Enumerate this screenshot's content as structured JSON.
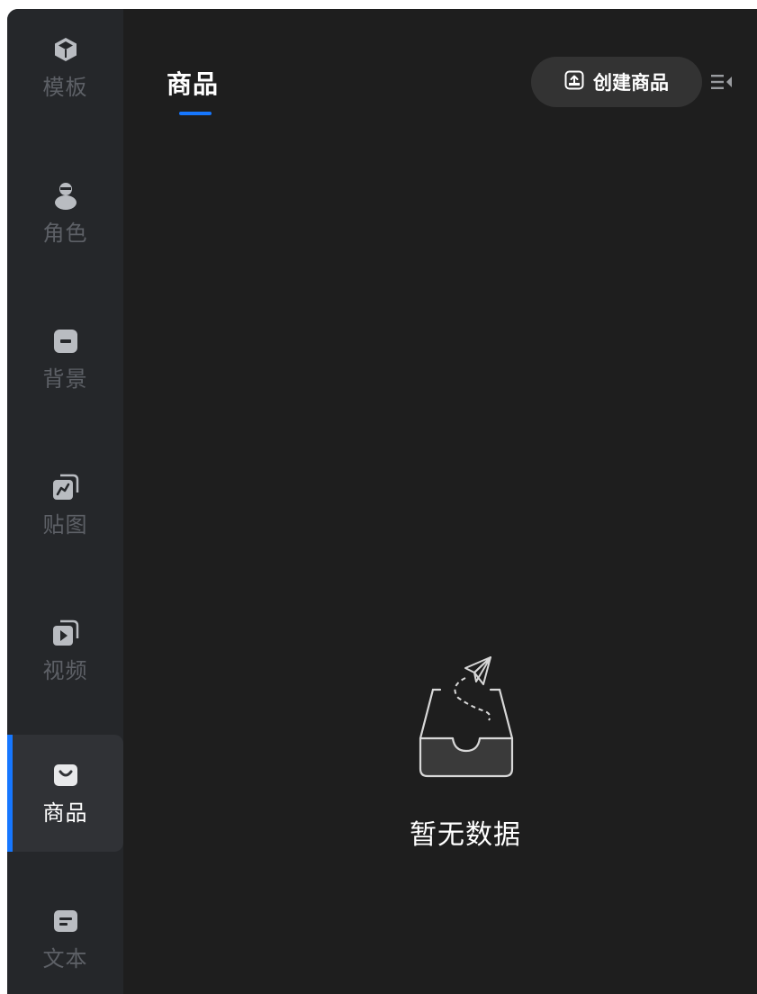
{
  "sidebar": {
    "items": [
      {
        "label": "模板",
        "icon": "cube-icon"
      },
      {
        "label": "角色",
        "icon": "person-icon"
      },
      {
        "label": "背景",
        "icon": "background-icon"
      },
      {
        "label": "贴图",
        "icon": "sticker-icon"
      },
      {
        "label": "视频",
        "icon": "video-icon"
      },
      {
        "label": "商品",
        "icon": "shopping-bag-icon",
        "active": true
      },
      {
        "label": "文本",
        "icon": "text-icon"
      }
    ]
  },
  "main": {
    "tab_label": "商品",
    "create_button_label": "创建商品",
    "empty_text": "暂无数据"
  },
  "colors": {
    "accent": "#1677ff",
    "sidebar_bg": "#25272a",
    "main_bg": "#1e1e1e",
    "active_item_bg": "#303236"
  }
}
